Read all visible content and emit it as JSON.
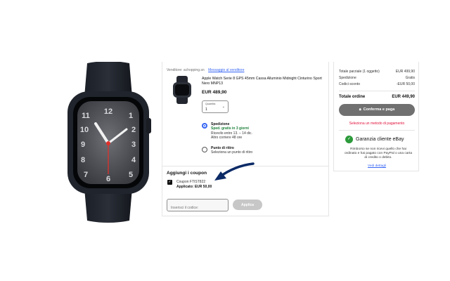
{
  "seller": {
    "label": "Venditore:",
    "name": "achopping.sn",
    "contact_link": "Messaggio al venditore"
  },
  "item": {
    "title": "Apple Watch Serie 8 GPS 45mm Cassa Alluminio Midnight Cinturino Sport Nero MNP13",
    "price": "EUR 489,90",
    "quantity_label": "Quantità",
    "quantity_value": "1"
  },
  "shipping": {
    "option_title": "Spedizione",
    "option_free": "Sped. gratis in 3 giorni",
    "option_eta": "Ricevilo entro 13. – 14 dic.",
    "option_more": "Altro corriere 48 ore",
    "pickup_title": "Punto di ritiro",
    "pickup_text": "Seleziona un punto di ritiro"
  },
  "coupon": {
    "heading": "Aggiungi i coupon",
    "code_name": "Coupon FTIST822",
    "applied": "Applicato: EUR 50,00",
    "input_placeholder": "Inserisci il codice:",
    "apply_label": "Applica"
  },
  "summary": {
    "rows": [
      {
        "label": "Totale parziale (1 oggetto)",
        "value": "EUR 499,90"
      },
      {
        "label": "Spedizione",
        "value": "Gratis"
      },
      {
        "label": "Codici sconto",
        "value": "-EUR 50,00"
      }
    ],
    "total_label": "Totale ordine",
    "total_value": "EUR 449,90",
    "pay_button": "Conferma e paga",
    "warning": "Seleziona un metodo di pagamento",
    "guarantee_title": "Garanzia cliente eBay",
    "guarantee_text": "Rimborso se non ricevi quello che hai ordinato e hai pagato con PayPal o una carta di credito o debito.",
    "guarantee_link": "Vedi dettagli"
  },
  "colors": {
    "link_blue": "#3665f3",
    "free_green": "#1a7f37",
    "warning_red": "#e0103a",
    "button_gray": "#707070",
    "arrow_navy": "#0b2a66"
  }
}
